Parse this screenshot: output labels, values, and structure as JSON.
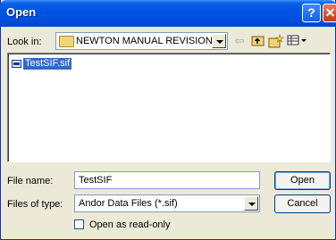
{
  "window": {
    "title": "Open",
    "help_label": "?",
    "close_label": "✕"
  },
  "look_in": {
    "label": "Look in:",
    "value": "NEWTON MANUAL REVISION"
  },
  "toolbar": {
    "back_icon": "back-arrow-icon",
    "up_icon": "up-folder-icon",
    "new_icon": "new-folder-icon",
    "view_icon": "view-menu-icon"
  },
  "files": [
    {
      "name": "TestSIF.sif",
      "selected": true
    }
  ],
  "file_name": {
    "label": "File name:",
    "value": "TestSIF"
  },
  "file_type": {
    "label": "Files of type:",
    "value": "Andor Data Files  (*.sif)"
  },
  "read_only": {
    "label": "Open as read-only",
    "checked": false
  },
  "buttons": {
    "open": "Open",
    "cancel": "Cancel"
  }
}
